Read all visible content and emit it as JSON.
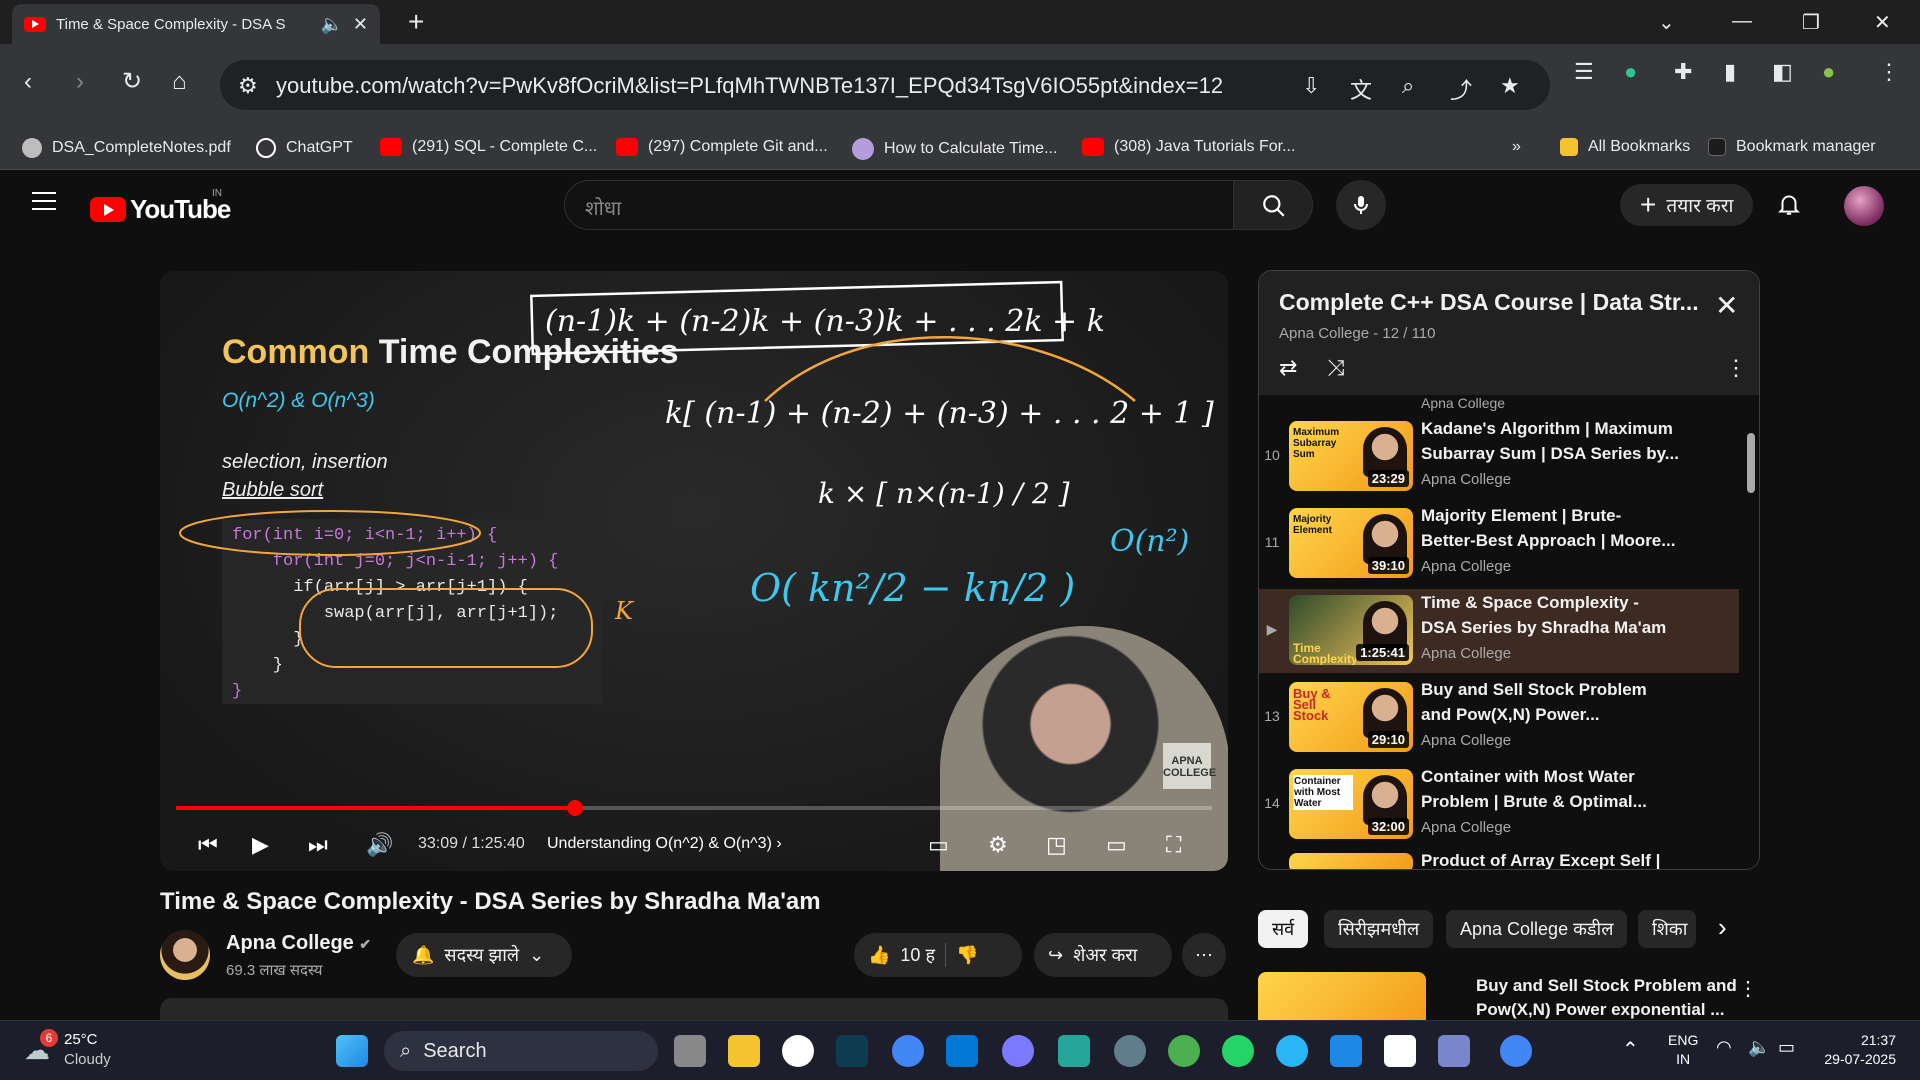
{
  "browser": {
    "tab_title": "Time & Space Complexity - DSA S",
    "url": "youtube.com/watch?v=PwKv8fOcriM&list=PLfqMhTWNBTe137I_EPQd34TsgV6IO55pt&index=12",
    "bookmarks": [
      {
        "label": "DSA_CompleteNotes.pdf",
        "color": "#cccccc"
      },
      {
        "label": "ChatGPT",
        "color": "#ffffff"
      },
      {
        "label": "(291) SQL - Complete C...",
        "color": "#ff0000"
      },
      {
        "label": "(297) Complete Git and...",
        "color": "#ff0000"
      },
      {
        "label": "How to Calculate Time...",
        "color": "#b39ddb"
      },
      {
        "label": "(308) Java Tutorials For...",
        "color": "#ff0000"
      }
    ],
    "bookmarks_more": "»",
    "all_bookmarks": "All Bookmarks",
    "bookmark_manager": "Bookmark manager"
  },
  "youtube": {
    "logo_text": "YouTube",
    "region": "IN",
    "search_placeholder": "शोधा",
    "create_label": "तयार करा"
  },
  "video": {
    "slide_title_accent": "Common",
    "slide_title_rest": " Time Complexities",
    "slide_subtitle": "O(n^2) & O(n^3)",
    "slide_note1": "selection, insertion",
    "slide_note2": "Bubble sort",
    "code_lines": [
      "for(int i=0; i<n-1; i++) {",
      "    for(int j=0; j<n-i-1; j++) {",
      "      if(arr[j] > arr[j+1]) {",
      "         swap(arr[j], arr[j+1]);",
      "      }",
      "    }",
      "}"
    ],
    "badge": "APNA COLLEGE",
    "progress": 0.3856,
    "time_current": "33:09",
    "time_total": "1:25:40",
    "time_display": "33:09 / 1:25:40",
    "chapter": "Understanding O(n^2) & O(n^3)",
    "title": "Time & Space Complexity - DSA Series by Shradha Ma'am",
    "channel": "Apna College",
    "subscribers": "69.3 लाख सदस्य",
    "subscribe_label": "सदस्य झाले",
    "likes": "10 ह",
    "share_label": "शेअर करा"
  },
  "playlist": {
    "title": "Complete C++ DSA Course | Data Str...",
    "subtitle": "Apna College - 12 / 110",
    "items": [
      {
        "index": "10",
        "line1": "Kadane's Algorithm | Maximum",
        "line2": "Subarray Sum | DSA Series by...",
        "channel": "Apna College",
        "duration": "23:29",
        "thumb_text": "Maximum Subarray Sum"
      },
      {
        "index": "11",
        "line1": "Majority Element | Brute-",
        "line2": "Better-Best Approach | Moore...",
        "channel": "Apna College",
        "duration": "39:10",
        "thumb_text": "Majority Element"
      },
      {
        "index": "▶",
        "line1": "Time & Space Complexity -",
        "line2": "DSA Series by Shradha Ma'am",
        "channel": "Apna College",
        "duration": "1:25:41",
        "thumb_text": "Time Complexity"
      },
      {
        "index": "13",
        "line1": "Buy and Sell Stock Problem",
        "line2": "and Pow(X,N) Power...",
        "channel": "Apna College",
        "duration": "29:10",
        "thumb_text": "Buy & Sell Stock"
      },
      {
        "index": "14",
        "line1": "Container with Most Water",
        "line2": "Problem | Brute & Optimal...",
        "channel": "Apna College",
        "duration": "32:00",
        "thumb_text": "Container with Most Water"
      }
    ],
    "partial_item": "Product of Array Except Self |"
  },
  "chips": [
    "सर्व",
    "सिरीझमधील",
    "Apna College कडील",
    "शिका"
  ],
  "recommendation": {
    "line1": "Buy and Sell Stock Problem and",
    "line2": "Pow(X,N) Power exponential ..."
  },
  "taskbar": {
    "weather_temp": "25°C",
    "weather_desc": "Cloudy",
    "weather_badge": "6",
    "search_label": "Search",
    "lang1": "ENG",
    "lang2": "IN",
    "time": "21:37",
    "date": "29-07-2025"
  }
}
